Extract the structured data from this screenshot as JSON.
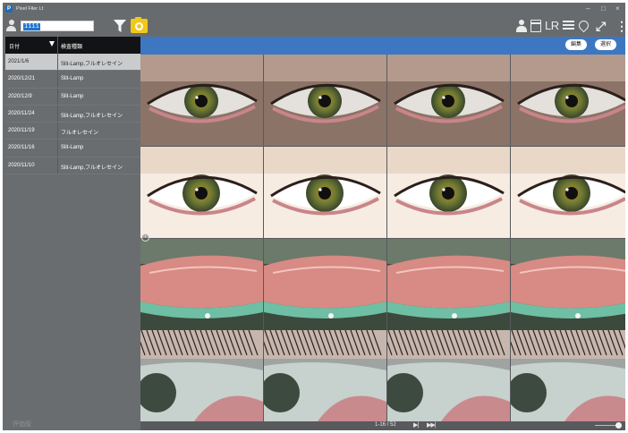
{
  "window": {
    "title": "Pixel Filer Lt",
    "app_icon": "P"
  },
  "toolbar": {
    "patient_id": "1111",
    "icons": [
      "user-icon",
      "filter-icon",
      "camera-icon",
      "patient-icon",
      "calendar-icon",
      "lr-icon",
      "list-view-icon",
      "pin-icon",
      "expand-icon",
      "more-icon"
    ],
    "lr_label": "LR",
    "accent": "#f2c71b"
  },
  "list": {
    "header": {
      "date": "日付",
      "type": "検査種類"
    },
    "rows": [
      {
        "date": "2021/1/6",
        "type": "Slit-Lamp,フルオレセイン",
        "selected": true
      },
      {
        "date": "2020/12/21",
        "type": "Slit-Lamp"
      },
      {
        "date": "2020/12/9",
        "type": "Slit-Lamp"
      },
      {
        "date": "2020/11/24",
        "type": "Slit-Lamp,フルオレセイン"
      },
      {
        "date": "2020/11/19",
        "type": "フルオレセイン"
      },
      {
        "date": "2020/11/16",
        "type": "Slit-Lamp"
      },
      {
        "date": "2020/11/10",
        "type": "Slit-Lamp,フルオレセイン"
      }
    ],
    "trial_label": "評価版"
  },
  "gallery": {
    "edit_label": "編集",
    "select_label": "選択",
    "bar_color": "#3d77c2",
    "page_counter": "1-16 / 52",
    "thumbnails": [
      "eye-open-green-iris",
      "eye-open-green-iris",
      "eye-open-green-iris",
      "eye-open-green-iris",
      "eye-wide-bright-green-iris",
      "eye-wide-bright-green-iris",
      "eye-wide-bright-green-iris",
      "eye-wide-bright-green-iris",
      "everted-eyelid-conjunctiva",
      "everted-eyelid-conjunctiva",
      "everted-eyelid-conjunctiva",
      "everted-eyelid-conjunctiva",
      "lower-lid-lashes-closeup",
      "lower-lid-lashes-closeup",
      "lower-lid-lashes-closeup",
      "lower-lid-lashes-closeup"
    ]
  }
}
